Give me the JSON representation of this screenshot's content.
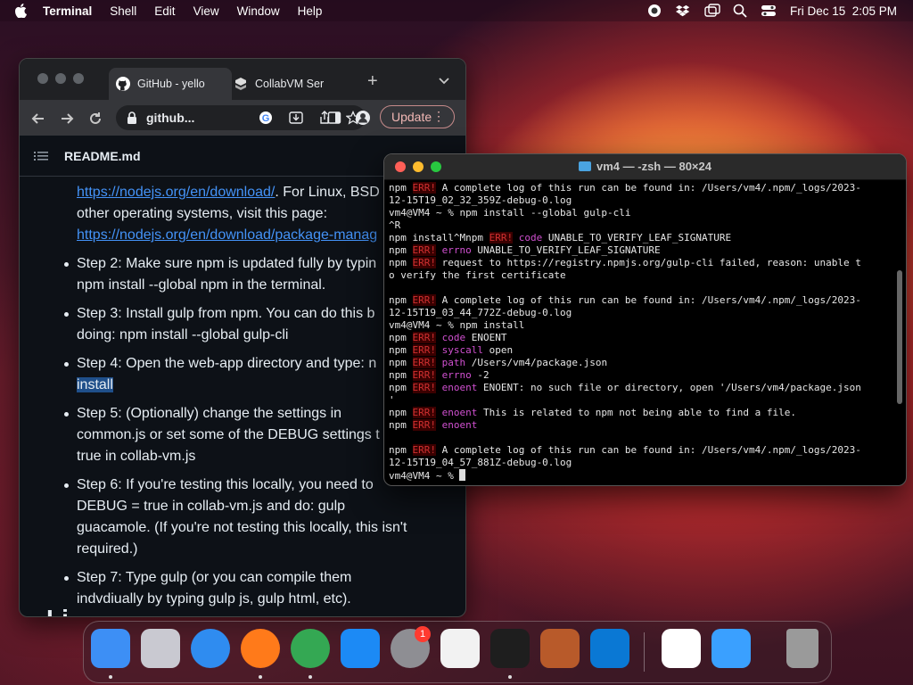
{
  "menubar": {
    "app_name": "Terminal",
    "items": [
      "Shell",
      "Edit",
      "View",
      "Window",
      "Help"
    ],
    "datetime": "Fri Dec 15  2:05 PM"
  },
  "browser": {
    "tabs": [
      {
        "label": "GitHub - yello"
      },
      {
        "label": "CollabVM Ser"
      }
    ],
    "url": "github...",
    "update_label": "Update",
    "readme_title": "README.md",
    "content": {
      "intro_link1": "https://nodejs.org/en/download/",
      "intro_text1": ". For Linux, BSD",
      "intro_text2": "other operating systems, visit this page:",
      "intro_link2": "https://nodejs.org/en/download/package-manag",
      "steps": [
        "Step 2: Make sure npm is updated fully by typin",
        "npm install --global npm in the terminal.",
        "Step 3: Install gulp from npm. You can do this b",
        "doing: npm install --global gulp-cli",
        "Step 4: Open the web-app directory and type: n",
        "install",
        "Step 5: (Optionally) change the settings in",
        "common.js or set some of the DEBUG settings t",
        "true in collab-vm.js",
        "Step 6: If you're testing this locally, you need to",
        "DEBUG = true in collab-vm.js and do: gulp",
        "guacamole. (If you're not testing this locally, this isn't",
        "required.)",
        "Step 7: Type gulp (or you can compile them",
        "indvdiually by typing gulp js, gulp html, etc)."
      ],
      "cutoff_heading": "Li"
    }
  },
  "terminal": {
    "title": "vm4 — -zsh — 80×24",
    "lines": [
      {
        "p": "npm ",
        "e": "ERR!",
        "k": "",
        "t": " A complete log of this run can be found in: /Users/vm4/.npm/_logs/2023-"
      },
      {
        "p": "",
        "e": "",
        "k": "",
        "t": "12-15T19_02_32_359Z-debug-0.log"
      },
      {
        "p": "",
        "e": "",
        "k": "",
        "t": "vm4@VM4 ~ % npm install --global gulp-cli"
      },
      {
        "p": "",
        "e": "",
        "k": "",
        "t": "^R"
      },
      {
        "p": "npm install^Mnpm ",
        "e": "ERR!",
        "k": " code",
        "t": " UNABLE_TO_VERIFY_LEAF_SIGNATURE"
      },
      {
        "p": "npm ",
        "e": "ERR!",
        "k": " errno",
        "t": " UNABLE_TO_VERIFY_LEAF_SIGNATURE"
      },
      {
        "p": "npm ",
        "e": "ERR!",
        "k": "",
        "t": " request to https://registry.npmjs.org/gulp-cli failed, reason: unable t"
      },
      {
        "p": "",
        "e": "",
        "k": "",
        "t": "o verify the first certificate"
      },
      {
        "p": "",
        "e": "",
        "k": "",
        "t": ""
      },
      {
        "p": "npm ",
        "e": "ERR!",
        "k": "",
        "t": " A complete log of this run can be found in: /Users/vm4/.npm/_logs/2023-"
      },
      {
        "p": "",
        "e": "",
        "k": "",
        "t": "12-15T19_03_44_772Z-debug-0.log"
      },
      {
        "p": "",
        "e": "",
        "k": "",
        "t": "vm4@VM4 ~ % npm install"
      },
      {
        "p": "npm ",
        "e": "ERR!",
        "k": " code",
        "t": " ENOENT"
      },
      {
        "p": "npm ",
        "e": "ERR!",
        "k": " syscall",
        "t": " open"
      },
      {
        "p": "npm ",
        "e": "ERR!",
        "k": " path",
        "t": " /Users/vm4/package.json"
      },
      {
        "p": "npm ",
        "e": "ERR!",
        "k": " errno",
        "t": " -2"
      },
      {
        "p": "npm ",
        "e": "ERR!",
        "k": " enoent",
        "t": " ENOENT: no such file or directory, open '/Users/vm4/package.json"
      },
      {
        "p": "",
        "e": "",
        "k": "",
        "t": "'"
      },
      {
        "p": "npm ",
        "e": "ERR!",
        "k": " enoent",
        "t": " This is related to npm not being able to find a file."
      },
      {
        "p": "npm ",
        "e": "ERR!",
        "k": " enoent",
        "t": ""
      },
      {
        "p": "",
        "e": "",
        "k": "",
        "t": ""
      },
      {
        "p": "npm ",
        "e": "ERR!",
        "k": "",
        "t": " A complete log of this run can be found in: /Users/vm4/.npm/_logs/2023-"
      },
      {
        "p": "",
        "e": "",
        "k": "",
        "t": "12-15T19_04_57_881Z-debug-0.log"
      },
      {
        "p": "",
        "e": "",
        "k": "",
        "t": "vm4@VM4 ~ % "
      }
    ]
  },
  "dock": {
    "apps": [
      {
        "name": "finder-icon",
        "color": "#3d8ff5"
      },
      {
        "name": "launchpad-icon",
        "color": "#c9c9d1"
      },
      {
        "name": "safari-icon",
        "color": "#2f8cf0"
      },
      {
        "name": "firefox-icon",
        "color": "#ff7a1a"
      },
      {
        "name": "chrome-icon",
        "color": "#34a853"
      },
      {
        "name": "app-store-icon",
        "color": "#1c8af5"
      },
      {
        "name": "system-settings-icon",
        "color": "#8e8e93"
      },
      {
        "name": "textedit-icon",
        "color": "#f2f2f2"
      },
      {
        "name": "terminal-icon",
        "color": "#1e1e1e"
      },
      {
        "name": "garageband-icon",
        "color": "#b85a2a"
      },
      {
        "name": "vscode-icon",
        "color": "#0a78d4"
      },
      {
        "name": "visual-studio-icon",
        "color": "#ffffff"
      },
      {
        "name": "weather-icon",
        "color": "#3aa0ff"
      },
      {
        "name": "trash-icon",
        "color": "#9a9a9a"
      }
    ],
    "settings_badge": "1"
  }
}
